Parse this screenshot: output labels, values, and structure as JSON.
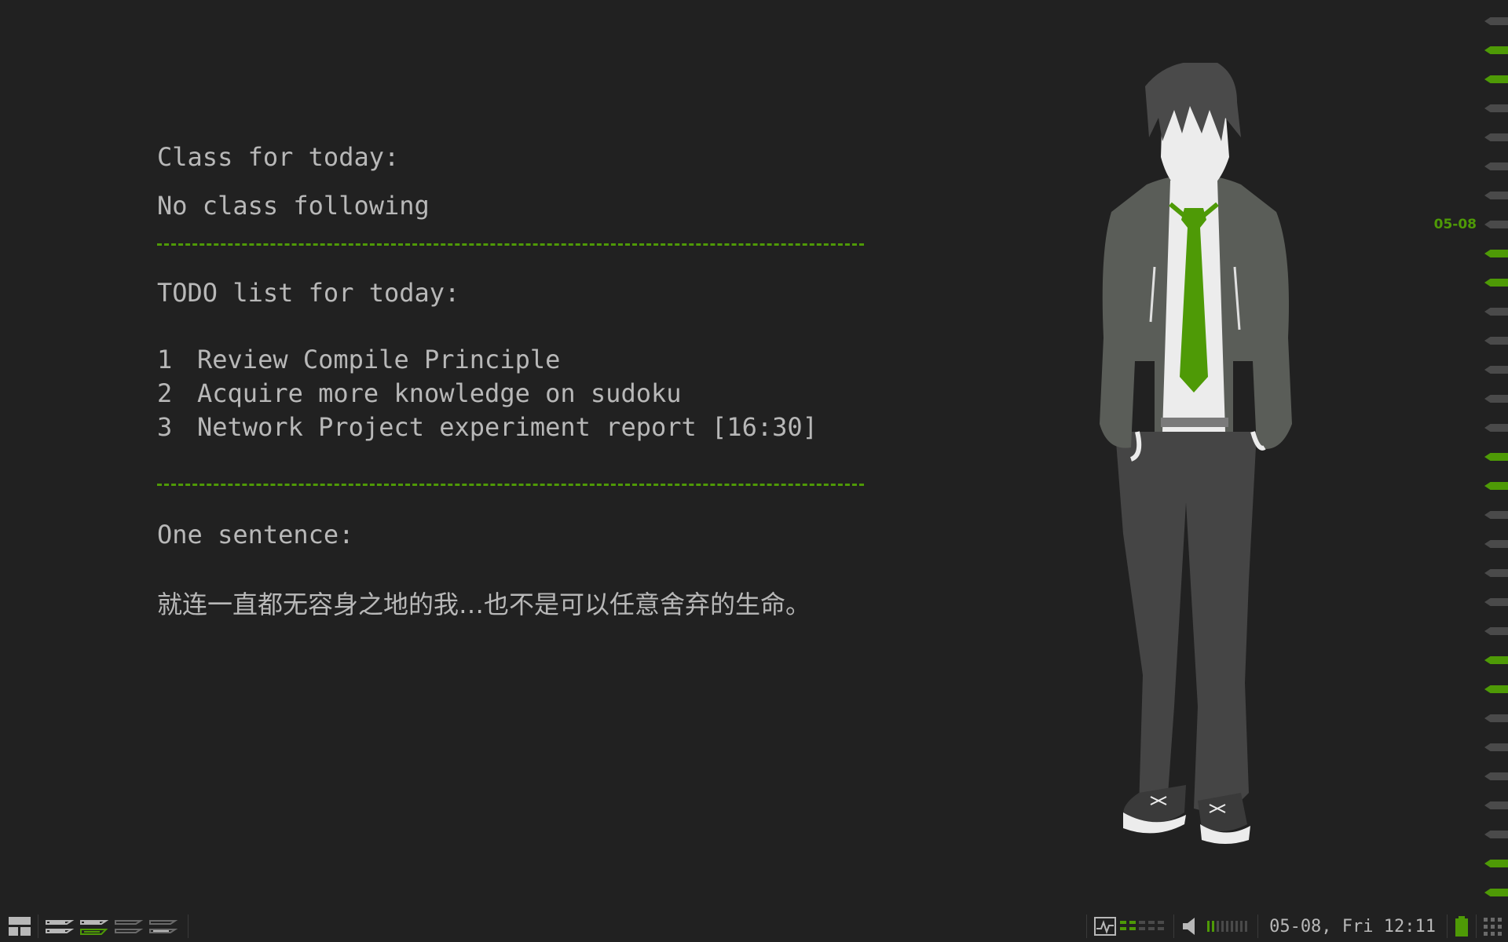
{
  "class_section": {
    "heading": "Class for today:",
    "status": "No class following"
  },
  "todo_section": {
    "heading": "TODO list for today:",
    "items": [
      {
        "num": "1",
        "text": "Review Compile Principle"
      },
      {
        "num": "2",
        "text": "Acquire more knowledge on sudoku"
      },
      {
        "num": "3",
        "text": "Network Project experiment report [16:30]"
      }
    ]
  },
  "sentence_section": {
    "heading": "One sentence:",
    "text": "就连一直都无容身之地的我…也不是可以任意舍弃的生命。"
  },
  "timeline": {
    "date_label": "05-08"
  },
  "statusbar": {
    "clock": "05-08, Fri 12:11",
    "layout_icon": "tile-layout-icon",
    "monitor_icon": "system-monitor-icon",
    "volume_icon": "speaker-icon",
    "battery_icon": "battery-icon",
    "menu_icon": "grid-menu-icon"
  },
  "colors": {
    "background": "#212121",
    "text": "#b8b8b8",
    "accent": "#4e9a06",
    "dim": "#4a4a4a"
  }
}
